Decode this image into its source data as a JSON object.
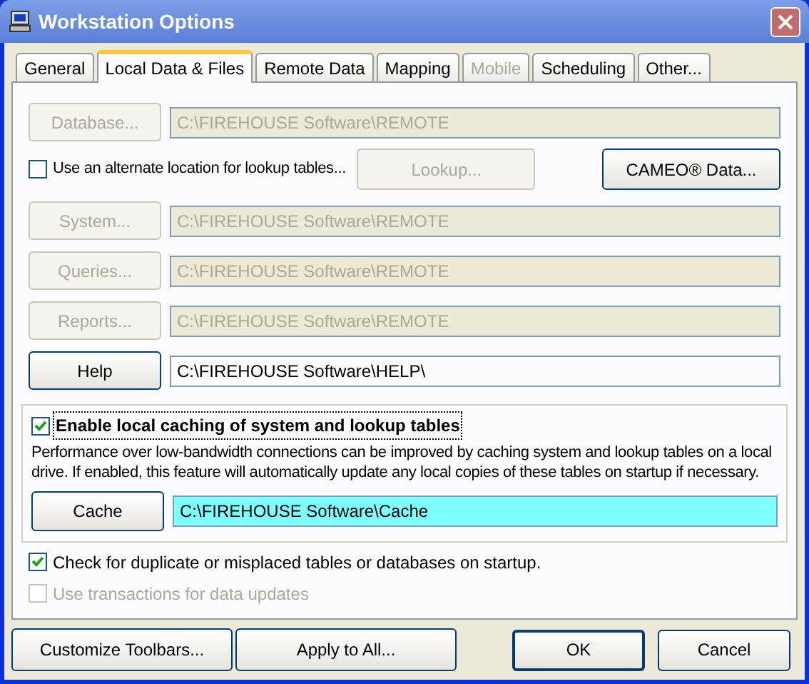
{
  "window": {
    "title": "Workstation Options"
  },
  "tabs": [
    {
      "label": "General",
      "selected": false,
      "disabled": false
    },
    {
      "label": "Local Data & Files",
      "selected": true,
      "disabled": false
    },
    {
      "label": "Remote Data",
      "selected": false,
      "disabled": false
    },
    {
      "label": "Mapping",
      "selected": false,
      "disabled": false
    },
    {
      "label": "Mobile",
      "selected": false,
      "disabled": true
    },
    {
      "label": "Scheduling",
      "selected": false,
      "disabled": false
    },
    {
      "label": "Other...",
      "selected": false,
      "disabled": false
    }
  ],
  "database": {
    "button": "Database...",
    "disabled": true,
    "path": "C:\\FIREHOUSE Software\\REMOTE"
  },
  "alternate_lookup": {
    "label": "Use an alternate location for lookup tables...",
    "checked": false,
    "lookup_button": "Lookup...",
    "lookup_disabled": true,
    "cameo_button": "CAMEO® Data..."
  },
  "paths": [
    {
      "button": "System...",
      "disabled": true,
      "path": "C:\\FIREHOUSE Software\\REMOTE"
    },
    {
      "button": "Queries...",
      "disabled": true,
      "path": "C:\\FIREHOUSE Software\\REMOTE"
    },
    {
      "button": "Reports...",
      "disabled": true,
      "path": "C:\\FIREHOUSE Software\\REMOTE"
    },
    {
      "button": "Help",
      "disabled": false,
      "path": "C:\\FIREHOUSE Software\\HELP\\"
    }
  ],
  "caching": {
    "label": "Enable local caching of system and lookup tables",
    "checked": true,
    "description": "Performance over low-bandwidth connections can be improved by caching system and lookup tables on a local drive. If enabled, this feature will automatically update any local copies of these tables on startup if necessary.",
    "button": "Cache",
    "path": "C:\\FIREHOUSE Software\\Cache"
  },
  "options": [
    {
      "label": "Check for duplicate or misplaced tables or databases on startup.",
      "checked": true,
      "disabled": false
    },
    {
      "label": "Use transactions for data updates",
      "checked": false,
      "disabled": true
    }
  ],
  "footer_buttons": [
    "Customize Toolbars...",
    "Apply to All...",
    "OK",
    "Cancel"
  ]
}
